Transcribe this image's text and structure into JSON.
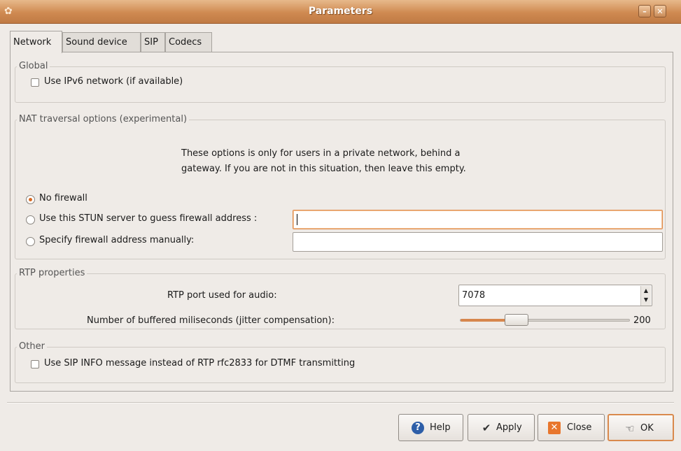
{
  "window": {
    "title": "Parameters"
  },
  "tabs": [
    "Network",
    "Sound device",
    "SIP",
    "Codecs"
  ],
  "global": {
    "label": "Global",
    "ipv6_label": "Use IPv6 network (if available)",
    "ipv6_checked": false
  },
  "nat": {
    "label": "NAT traversal options (experimental)",
    "info_line1": "These options is only for users in a private network, behind a",
    "info_line2": "gateway. If you are not in this situation, then leave this empty.",
    "options": [
      "No firewall",
      "Use this STUN server to guess firewall address :",
      "Specify firewall address manually:"
    ],
    "selected": "No firewall",
    "stun_value": "",
    "manual_value": ""
  },
  "rtp": {
    "label": "RTP properties",
    "port_label": "RTP port used for audio:",
    "port_value": "7078",
    "jitter_label": "Number of buffered miliseconds (jitter compensation):",
    "jitter_value": "200"
  },
  "other": {
    "label": "Other",
    "sip_info_label": "Use SIP INFO message instead of RTP rfc2833 for DTMF transmitting",
    "sip_info_checked": false
  },
  "buttons": {
    "help": "Help",
    "apply": "Apply",
    "close": "Close",
    "ok": "OK"
  },
  "icons": {
    "app": "app-icon",
    "minimize": "minimize-icon",
    "close": "close-icon",
    "help": "help-icon",
    "apply": "checkmark-icon",
    "window_close": "close-x-icon",
    "ok": "ok-icon"
  }
}
